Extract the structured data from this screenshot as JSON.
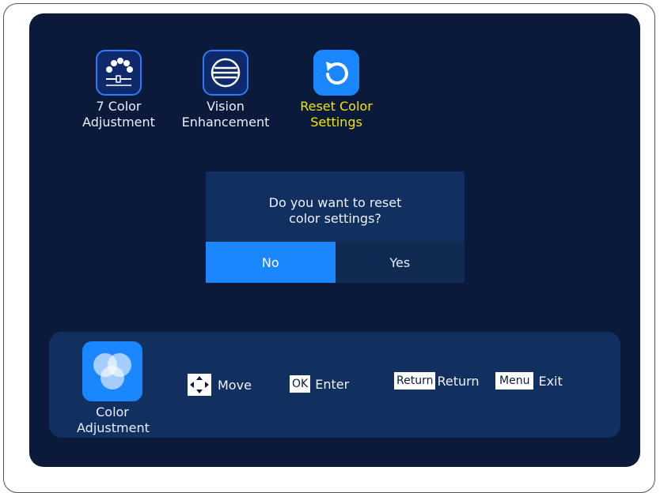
{
  "menu": {
    "items": [
      {
        "label": "7 Color\nAdjustment",
        "icon": "color-slider-icon"
      },
      {
        "label": "Vision\nEnhancement",
        "icon": "lines-circle-icon"
      },
      {
        "label": "Reset Color\nSettings",
        "icon": "reset-icon",
        "active": true
      }
    ]
  },
  "dialog": {
    "message": "Do you want to reset\ncolor settings?",
    "no_label": "No",
    "yes_label": "Yes",
    "selected": "No"
  },
  "bottom_bar": {
    "category_label": "Color\nAdjustment",
    "category_icon": "color-overlap-icon",
    "hints": {
      "move_label": "Move",
      "ok_key": "OK",
      "enter_label": "Enter",
      "return_key": "Return",
      "return_label": "Return",
      "menu_key": "Menu",
      "exit_label": "Exit"
    }
  },
  "colors": {
    "background": "#0b1a3a",
    "accent": "#1a86ff",
    "active_text": "#f2e600",
    "panel": "#12305f"
  }
}
